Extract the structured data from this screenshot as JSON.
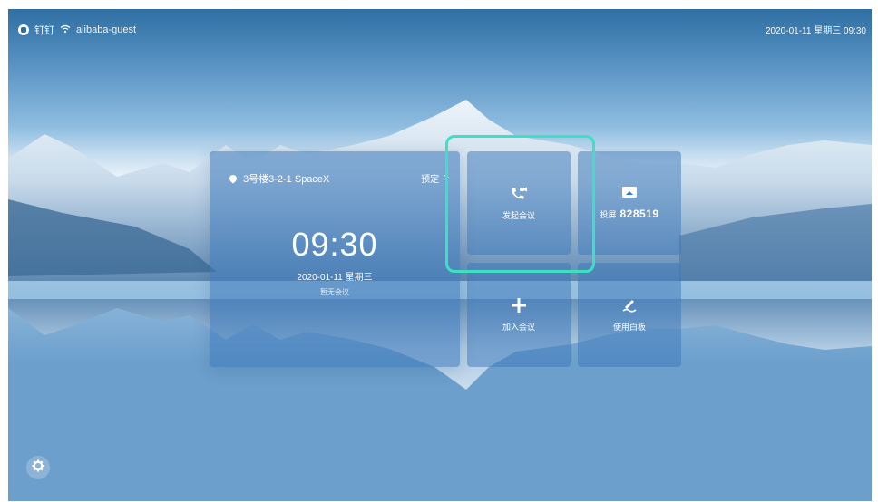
{
  "status_bar": {
    "app_name": "钉钉",
    "ssid": "alibaba-guest",
    "datetime": "2020-01-11 星期三 09:30",
    "wifi_icon": "wifi-icon",
    "logo_icon": "dingtalk-logo-icon"
  },
  "info_card": {
    "location": "3号楼3-2-1 SpaceX",
    "reserve_label": "预定",
    "reserve_chevron": ">",
    "time": "09:30",
    "date": "2020-01-11 星期三",
    "status": "暂无会议"
  },
  "tiles": {
    "start_meeting": {
      "label": "发起会议",
      "icon": "phone-video-icon"
    },
    "cast_screen": {
      "label": "投屏",
      "code": "828519",
      "icon": "cast-icon"
    },
    "join_meeting": {
      "label": "加入会议",
      "icon": "plus-icon"
    },
    "whiteboard": {
      "label": "使用白板",
      "icon": "pen-icon"
    }
  },
  "settings": {
    "icon": "gear-icon"
  },
  "colors": {
    "highlight": "#3de0c2",
    "panel": "#3c78b9"
  }
}
